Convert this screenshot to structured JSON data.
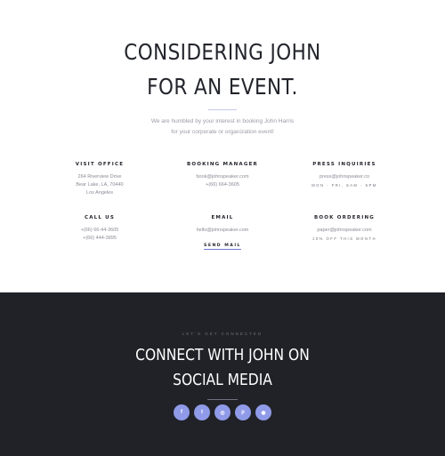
{
  "hero": {
    "title_line1": "CONSIDERING JOHN",
    "title_line2": "FOR AN EVENT.",
    "intro_line1": "We are humbled by your interest in booking John Harris",
    "intro_line2": "for your corporate or organization event!"
  },
  "contacts": [
    {
      "label": "VISIT OFFICE",
      "lines": [
        "264 Riverview Drive",
        "Bear Lake, LA, 70440",
        "Los Angeles"
      ]
    },
    {
      "label": "BOOKING MANAGER",
      "lines": [
        "book@johnspeaker.com",
        "+(66) 664-3605"
      ]
    },
    {
      "label": "PRESS INQUIRIES",
      "lines": [
        "press@johnspeaker.co"
      ],
      "small": "MON - FRI, 8AM - 5PM"
    },
    {
      "label": "CALL US",
      "lines": [
        "+(66) 66-44-3605",
        "+(66) 444-3895"
      ]
    },
    {
      "label": "EMAIL",
      "lines": [
        "hello@johnspeaker.com"
      ],
      "link": "SEND MAIL"
    },
    {
      "label": "BOOK ORDERING",
      "lines": [
        "paper@johnspeaker.com"
      ],
      "small": "10% OFF THIS MONTH"
    }
  ],
  "social": {
    "eyebrow": "LET'S GET CONNECTED",
    "title_line1": "CONNECT WITH JOHN ON",
    "title_line2": "SOCIAL MEDIA",
    "icons": [
      {
        "name": "facebook-icon",
        "glyph": "f"
      },
      {
        "name": "twitter-icon",
        "glyph": "t"
      },
      {
        "name": "instagram-icon",
        "glyph": "◎"
      },
      {
        "name": "pinterest-icon",
        "glyph": "p"
      },
      {
        "name": "dribbble-icon",
        "glyph": "◉"
      }
    ]
  }
}
